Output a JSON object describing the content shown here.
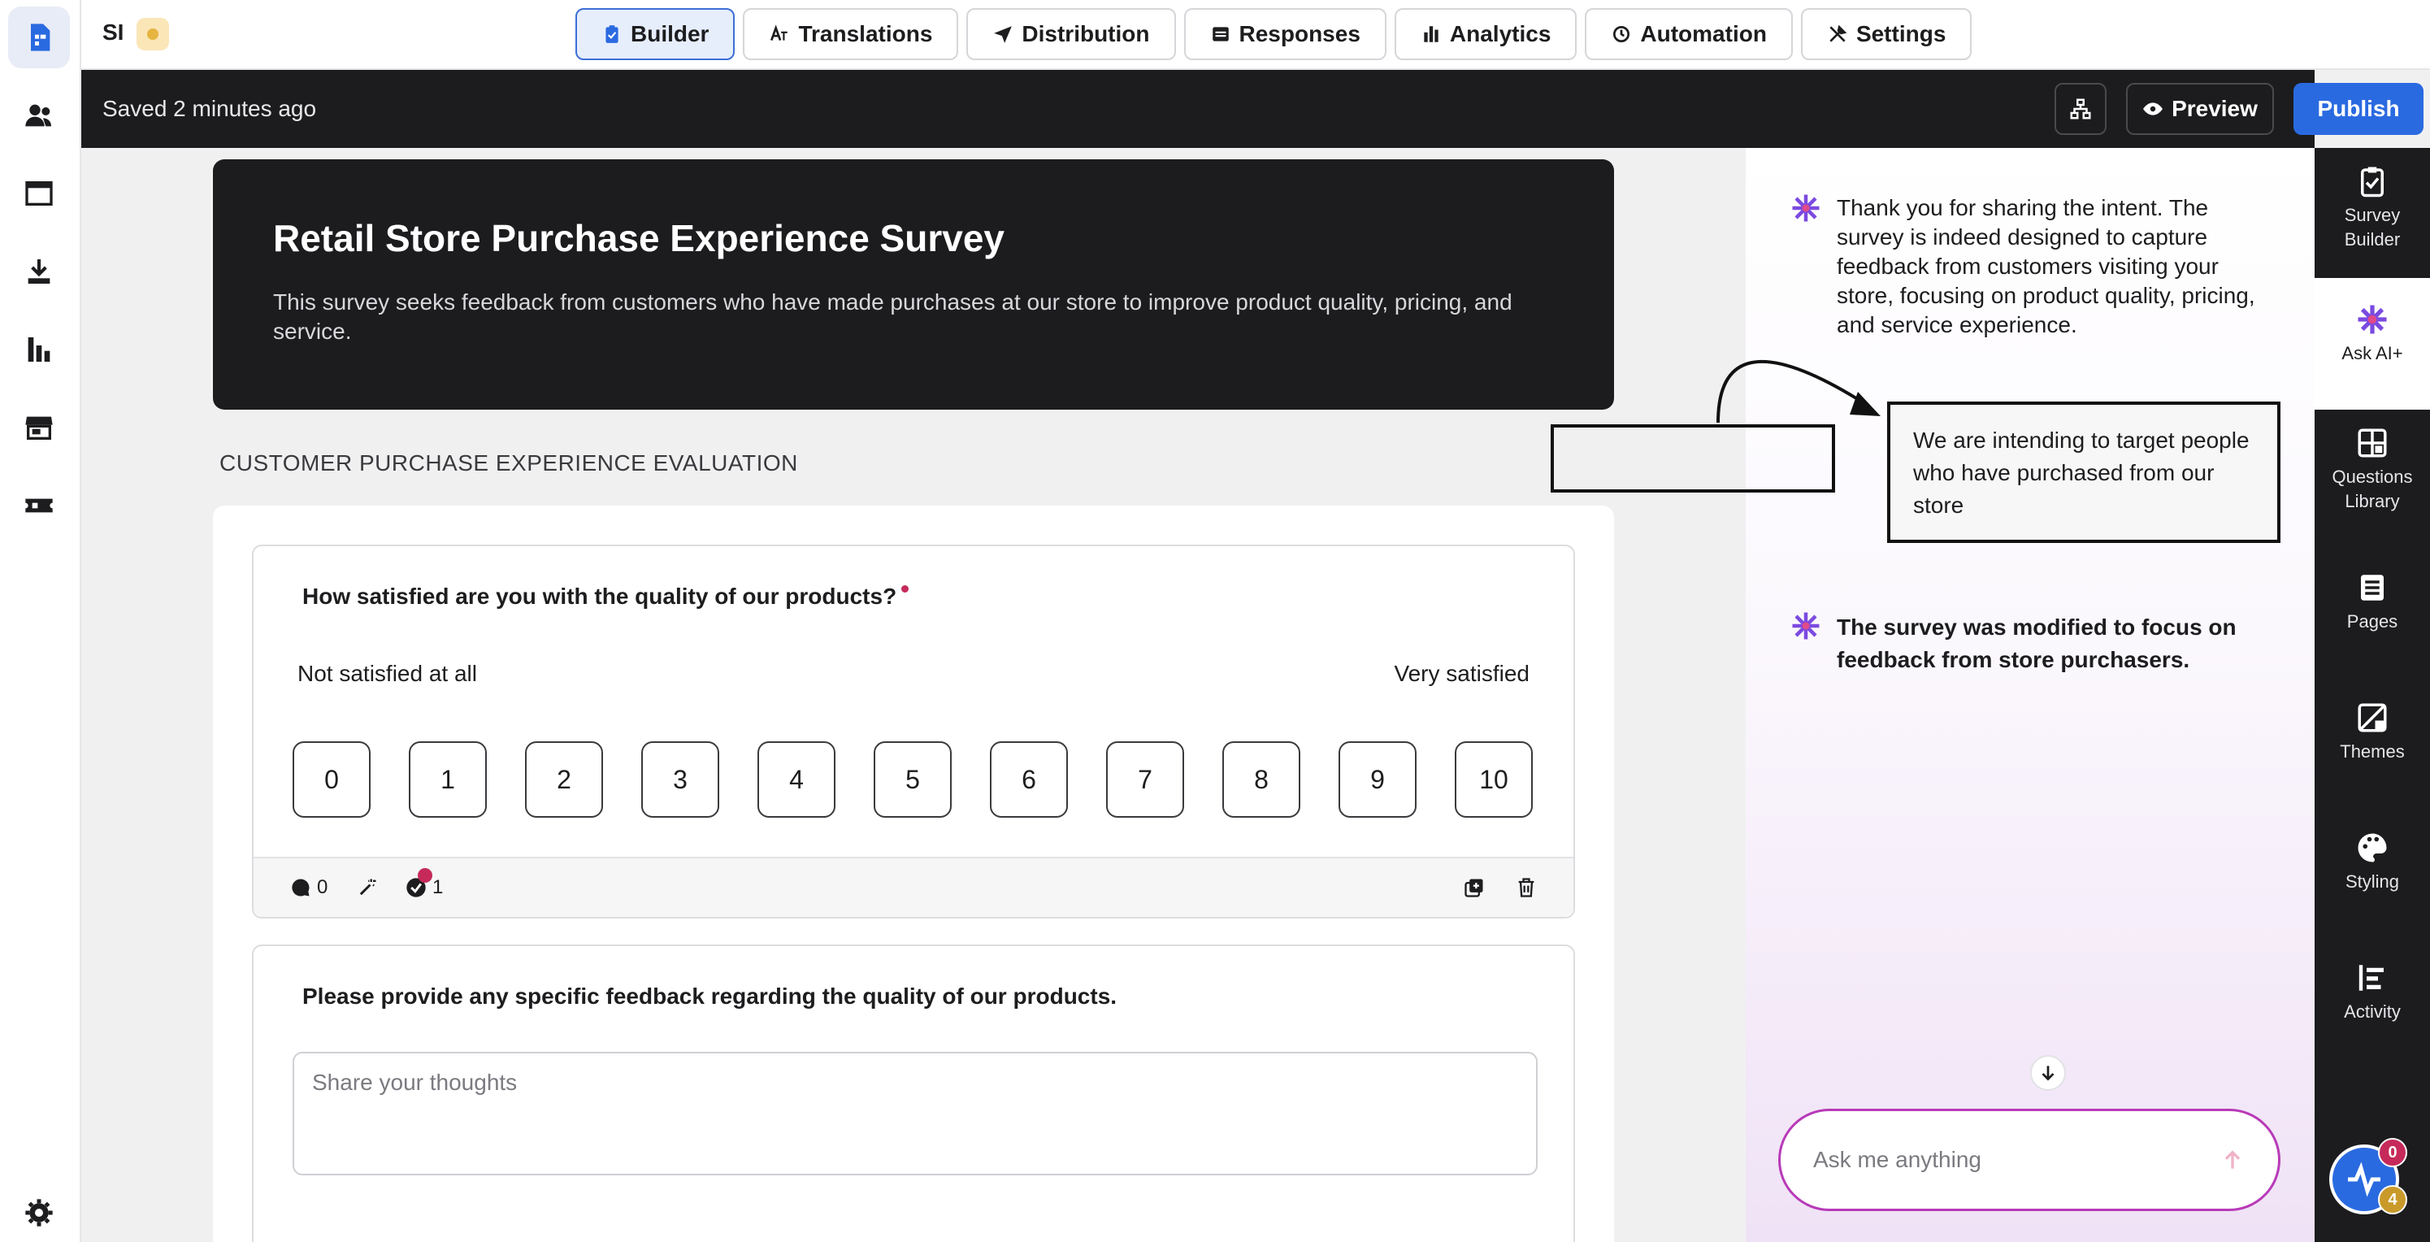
{
  "app": {
    "logo_text": "SI"
  },
  "tabs": [
    {
      "label": "Builder",
      "icon": "clipboard-icon",
      "active": true
    },
    {
      "label": "Translations",
      "icon": "translate-icon",
      "active": false
    },
    {
      "label": "Distribution",
      "icon": "send-icon",
      "active": false
    },
    {
      "label": "Responses",
      "icon": "responses-icon",
      "active": false
    },
    {
      "label": "Analytics",
      "icon": "bar-chart-icon",
      "active": false
    },
    {
      "label": "Automation",
      "icon": "automation-icon",
      "active": false
    },
    {
      "label": "Settings",
      "icon": "tools-icon",
      "active": false
    }
  ],
  "toolbar": {
    "saved_status": "Saved 2 minutes ago",
    "preview_label": "Preview",
    "publish_label": "Publish"
  },
  "survey": {
    "title": "Retail Store Purchase Experience Survey",
    "description": "This survey seeks feedback from customers who have made purchases at our store to improve product quality, pricing, and service.",
    "section_label": "CUSTOMER PURCHASE EXPERIENCE EVALUATION",
    "questions": [
      {
        "text": "How satisfied are you with the quality of our products?",
        "required": true,
        "scale_min_label": "Not satisfied at all",
        "scale_max_label": "Very satisfied",
        "scale": [
          "0",
          "1",
          "2",
          "3",
          "4",
          "5",
          "6",
          "7",
          "8",
          "9",
          "10"
        ],
        "comments_count": "0",
        "logic_count": "1"
      },
      {
        "text": "Please provide any specific feedback regarding the quality of our products.",
        "placeholder": "Share your thoughts"
      }
    ]
  },
  "ai_panel": {
    "messages": [
      {
        "role": "ai",
        "text": "Thank you for sharing the intent. The survey is indeed designed to capture feedback from customers visiting your store, focusing on product quality, pricing, and service experience."
      },
      {
        "role": "user",
        "text": "We are intending to target people who have purchased from our store"
      },
      {
        "role": "ai",
        "text": "The survey was modified to focus on feedback from store purchasers."
      }
    ],
    "input_placeholder": "Ask me anything"
  },
  "right_rail": [
    {
      "label": "Survey Builder",
      "icon": "clipboard-check-icon",
      "active": false
    },
    {
      "label": "Ask AI+",
      "icon": "sparkle-icon",
      "active": true
    },
    {
      "label": "Questions Library",
      "icon": "library-icon",
      "active": false
    },
    {
      "label": "Pages",
      "icon": "pages-icon",
      "active": false
    },
    {
      "label": "Themes",
      "icon": "themes-icon",
      "active": false
    },
    {
      "label": "Styling",
      "icon": "palette-icon",
      "active": false
    },
    {
      "label": "Activity",
      "icon": "activity-icon",
      "active": false
    }
  ],
  "help": {
    "badge_top": "0",
    "badge_bottom": "4"
  },
  "colors": {
    "accent": "#2a6ae0",
    "dark": "#1c1c1e",
    "ai_border": "#b83ab8",
    "required": "#c62a5a"
  }
}
